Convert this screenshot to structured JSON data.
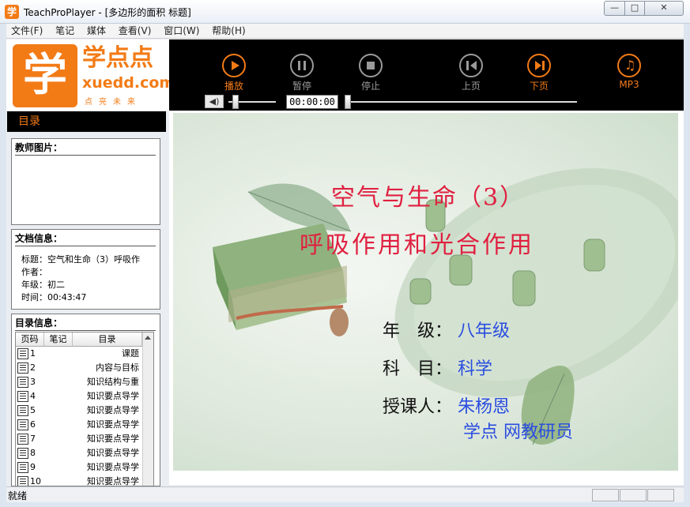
{
  "window": {
    "app_icon": "学",
    "title": "TeachProPlayer - [多边形的面积 标题]",
    "controls": {
      "minimize": "—",
      "maximize": "□",
      "close": "✕"
    }
  },
  "menu": [
    "文件(F)",
    "笔记",
    "媒体",
    "查看(V)",
    "窗口(W)",
    "帮助(H)"
  ],
  "logo": {
    "mark": "学",
    "brand": "学点点",
    "url": "xuedd.com",
    "tagline": "点亮未来"
  },
  "player": {
    "buttons": [
      {
        "label": "播放",
        "icon": "play-icon",
        "active": true
      },
      {
        "label": "暂停",
        "icon": "pause-icon",
        "active": false
      },
      {
        "label": "停止",
        "icon": "stop-icon",
        "active": false
      },
      {
        "label": "上页",
        "icon": "previous-page-icon",
        "active": false
      },
      {
        "label": "下页",
        "icon": "next-page-icon",
        "active": true
      },
      {
        "label": "MP3",
        "icon": "music-note-icon",
        "active": true
      }
    ],
    "time": "00:00:00",
    "volume_icon": "speaker-icon"
  },
  "sidebar": {
    "header": "目录",
    "teacher_title": "教师图片：",
    "doc_title": "文档信息：",
    "doc_lines": {
      "title": "标题：空气和生命（3）呼吸作",
      "author": "作者：",
      "grade": "年级：初二",
      "time": "时间：00:43:47"
    },
    "dir_title": "目录信息：",
    "dir_columns": [
      "页码",
      "笔记",
      "目录"
    ],
    "dir_rows": [
      {
        "num": "1",
        "name": "课题"
      },
      {
        "num": "2",
        "name": "内容与目标"
      },
      {
        "num": "3",
        "name": "知识结构与重"
      },
      {
        "num": "4",
        "name": "知识要点导学"
      },
      {
        "num": "5",
        "name": "知识要点导学"
      },
      {
        "num": "6",
        "name": "知识要点导学"
      },
      {
        "num": "7",
        "name": "知识要点导学"
      },
      {
        "num": "8",
        "name": "知识要点导学"
      },
      {
        "num": "9",
        "name": "知识要点导学"
      },
      {
        "num": "10",
        "name": "知识要点导学"
      }
    ]
  },
  "slide": {
    "title": "空气与生命（3）",
    "subtitle": "呼吸作用和光合作用",
    "grade_label": "年　级：",
    "grade_value": "八年级",
    "subject_label": "科　目：",
    "subject_value": "科学",
    "teacher_label": "授课人：",
    "teacher_value": "朱杨恩",
    "teacher_org": "学点 网教研员",
    "colors": {
      "title": "#e02040",
      "value": "#2a4de0"
    }
  },
  "status": {
    "text": "就绪"
  }
}
